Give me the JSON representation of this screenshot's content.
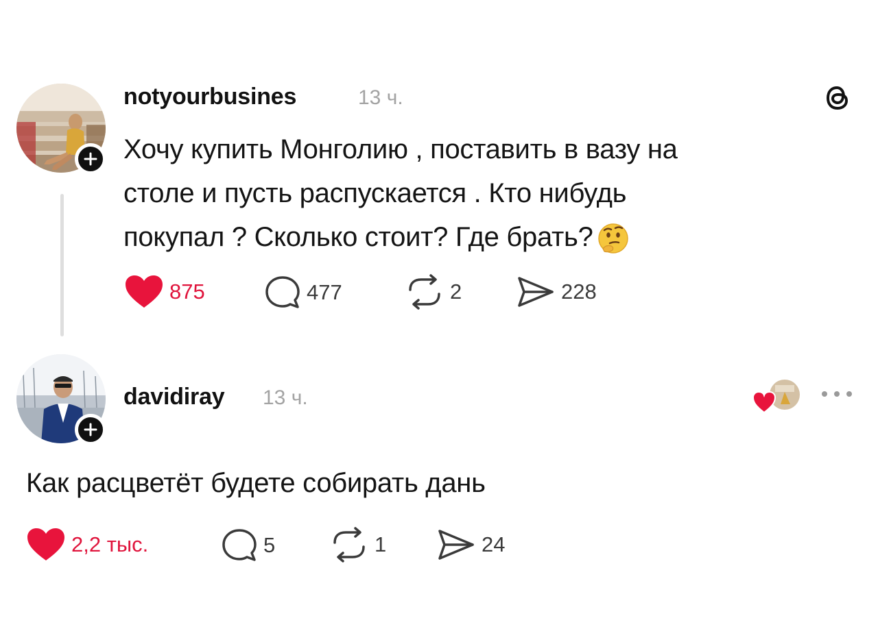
{
  "post": {
    "username": "notyourbusines",
    "timestamp": "13 ч.",
    "text_lines": [
      "Хочу купить Монголию , поставить в вазу на",
      "столе и пусть распускается . Кто нибудь",
      "покупал ? Сколько стоит? Где брать?"
    ],
    "emoji": "thinking-face",
    "actions": {
      "likes": "875",
      "comments": "477",
      "reposts": "2",
      "shares": "228"
    }
  },
  "reply": {
    "username": "davidiray",
    "timestamp": "13 ч.",
    "text": "Как расцветёт будете собирать дань",
    "actions": {
      "likes": "2,2 тыс.",
      "comments": "5",
      "reposts": "1",
      "shares": "24"
    }
  },
  "icons": {
    "header": "threads-logo-icon",
    "follow": "plus-icon",
    "like": "heart-icon",
    "comment": "speech-bubble-icon",
    "repost": "repost-icon",
    "share": "paper-plane-icon",
    "more": "ellipsis-icon"
  },
  "colors": {
    "like_red": "#e8143c",
    "text": "#141414",
    "muted": "#a3a3a3",
    "thread_line": "#dedede"
  }
}
